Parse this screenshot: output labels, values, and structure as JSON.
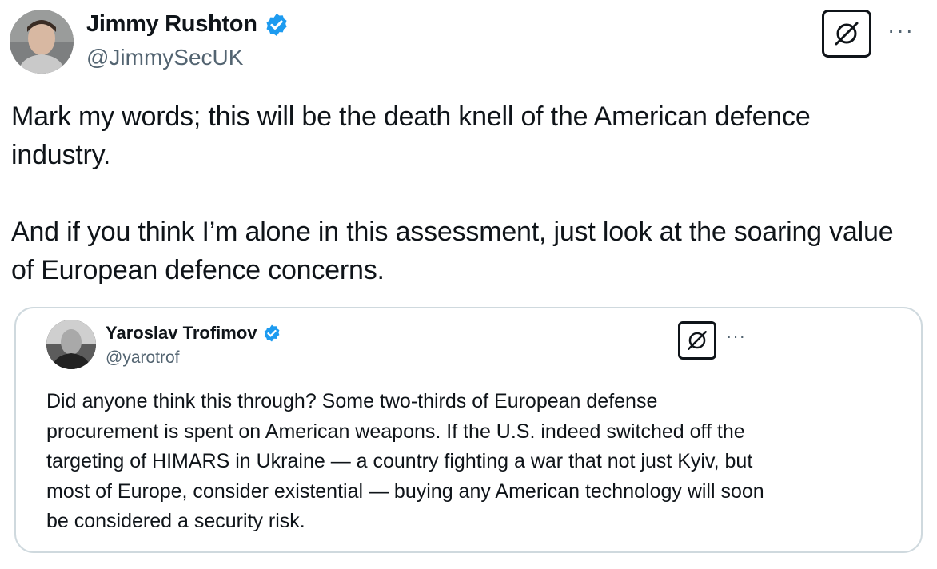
{
  "author": {
    "name": "Jimmy Rushton",
    "handle": "@JimmySecUK",
    "verified_color": "#1d9bf0"
  },
  "actions": {
    "grok_icon": "grok-icon",
    "more_label": "···"
  },
  "tweet": {
    "paragraphs": [
      "Mark my words; this will be the death knell of the American defence industry.",
      "And if you think I’m alone in this assessment, just look at the soaring value of European defence concerns."
    ]
  },
  "quoted": {
    "name": "Yaroslav Trofimov",
    "handle": "@yarotrof",
    "more_label": "···",
    "text": "Did anyone think this through? Some two-thirds of European defense procurement is spent on American weapons. If the U.S. indeed switched off the targeting of HIMARS in Ukraine — a country fighting a war that not just Kyiv, but most of Europe, consider existential — buying any American technology will soon be considered a security risk."
  }
}
